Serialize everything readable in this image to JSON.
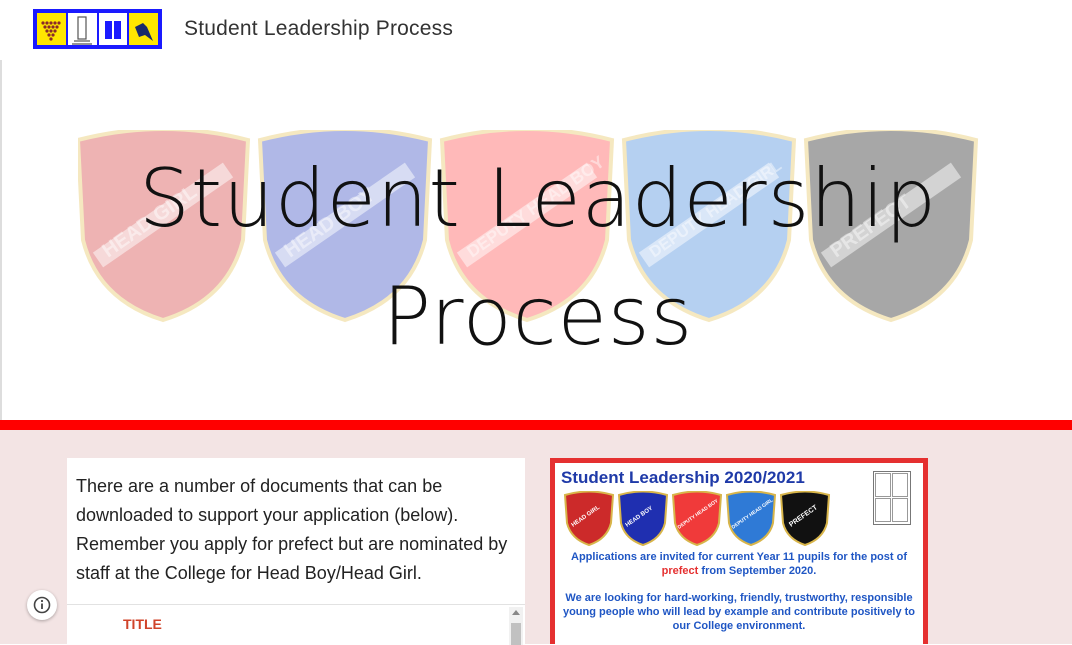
{
  "header": {
    "site_title": "Student Leadership Process",
    "logo_colors": [
      "#ffe600",
      "#ffffff",
      "#ffffff",
      "#ffe600"
    ],
    "logo_border": "#1a1aff"
  },
  "hero": {
    "title_line1": "Student Leadership",
    "title_line2": "Process",
    "badges": [
      {
        "label": "HEAD GIRL",
        "color": "#d33a3a"
      },
      {
        "label": "HEAD BOY",
        "color": "#3248c2"
      },
      {
        "label": "DEPUTY HEAD BOY",
        "color": "#ff4a4a"
      },
      {
        "label": "DEPUTY HEAD GIRL",
        "color": "#3f86dc"
      },
      {
        "label": "PREFECT",
        "color": "#1a1a1a"
      }
    ]
  },
  "divider_color": "#ff0000",
  "content": {
    "intro_text": "There are a number of documents that can be downloaded to support your application (below). Remember you apply for prefect but are nominated by staff at the College for Head Boy/Head Girl.",
    "table_header": "TITLE"
  },
  "poster": {
    "title": "Student Leadership 2020/2021",
    "p1_before": "Applications are invited for current Year 11 pupils for the post of",
    "p1_highlight": "prefect",
    "p1_after": "from September 2020.",
    "p2": "We are looking for hard-working, friendly, trustworthy, responsible young people who will lead by example and contribute positively to our College environment."
  }
}
